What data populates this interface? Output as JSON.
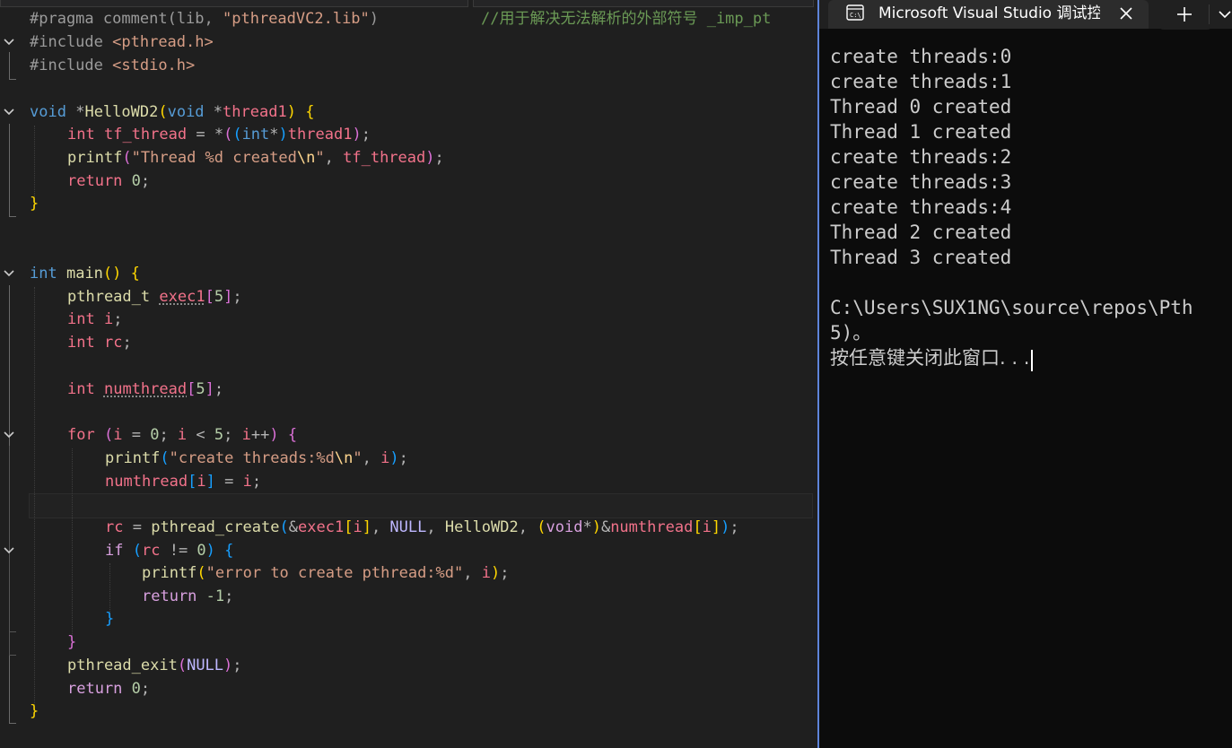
{
  "editor": {
    "lines": {
      "l1a": "#pragma",
      "l1b": "comment",
      "l1c": "lib",
      "l1d": "\"pthreadVC2.lib\"",
      "l1e": "//用于解决无法解析的外部符号 _imp_pt",
      "l2a": "#include",
      "l2b": "<pthread.h>",
      "l3a": "#include",
      "l3b": "<stdio.h>",
      "l5a": "void",
      "l5b": "HelloWD2",
      "l5c": "void",
      "l5d": "thread1",
      "l6a": "int",
      "l6b": "tf_thread",
      "l6c": "int",
      "l6d": "thread1",
      "l7a": "printf",
      "l7b": "\"Thread %d created",
      "l7c": "\\n",
      "l7d": "\"",
      "l7e": "tf_thread",
      "l8a": "return",
      "l8b": "0",
      "l12a": "int",
      "l12b": "main",
      "l13a": "pthread_t",
      "l13b": "exec1",
      "l13c": "5",
      "l14a": "int",
      "l14b": "i",
      "l15a": "int",
      "l15b": "rc",
      "l17a": "int",
      "l17b": "numthread",
      "l17c": "5",
      "l19a": "for",
      "l19b": "i",
      "l19c": "0",
      "l19d": "i",
      "l19e": "5",
      "l19f": "i",
      "l20a": "printf",
      "l20b": "\"create threads:%d",
      "l20c": "\\n",
      "l20d": "\"",
      "l20e": "i",
      "l21a": "numthread",
      "l21b": "i",
      "l21c": "i",
      "l23a": "rc",
      "l23b": "pthread_create",
      "l23c": "exec1",
      "l23d": "i",
      "l23e": "NULL",
      "l23f": "HelloWD2",
      "l23g": "void",
      "l23h": "numthread",
      "l23i": "i",
      "l24a": "if",
      "l24b": "rc",
      "l24c": "0",
      "l25a": "printf",
      "l25b": "\"error to create pthread:%d\"",
      "l25c": "i",
      "l26a": "return",
      "l26b": "-1",
      "l30a": "pthread_exit",
      "l30b": "NULL",
      "l31a": "return",
      "l31b": "0"
    }
  },
  "terminal": {
    "tab_title": "Microsoft Visual Studio 调试控制台",
    "output": [
      "create threads:0",
      "create threads:1",
      "Thread 0 created",
      "Thread 1 created",
      "create threads:2",
      "create threads:3",
      "create threads:4",
      "Thread 2 created",
      "Thread 3 created",
      "",
      "C:\\Users\\SUX1NG\\source\\repos\\Pth",
      "5)。",
      "按任意键关闭此窗口. . ."
    ]
  },
  "colors": {
    "editor_bg": "#1f1f1f",
    "terminal_bg": "#0c0c0c",
    "tab_active": "#2c2c2c",
    "terminal_border": "#5e84d8"
  }
}
